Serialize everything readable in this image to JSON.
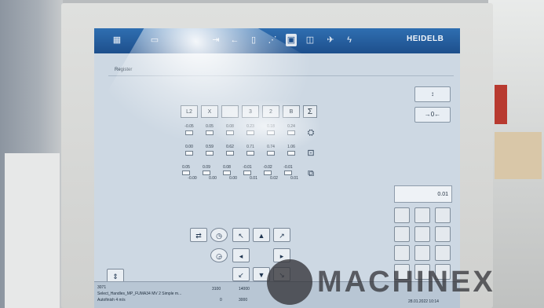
{
  "window": {
    "brand": "HEIDELB"
  },
  "toolbar": {
    "icons": [
      "grid-icon",
      "page-icon",
      "arrow-in-icon",
      "arrow-left-icon",
      "gauge-icon",
      "ink-icon",
      "lock-icon",
      "pile-icon",
      "plane-icon",
      "lightning-icon"
    ]
  },
  "tabs": [
    {
      "label": "Register"
    }
  ],
  "side": {
    "btn1": "↕",
    "btn2": "→0←"
  },
  "grid": {
    "headers": [
      "L2",
      "X",
      "",
      "3",
      "2",
      "B",
      "Σ"
    ],
    "row1": [
      "-0.05",
      "0.05",
      "0.08",
      "0.23",
      "0.18",
      "0.24"
    ],
    "row2": [
      "0.00",
      "0.59",
      "0.62",
      "0.71",
      "0.74",
      "1.06"
    ],
    "row3": [
      "0.05",
      "0.09",
      "0.08",
      "-0.01",
      "-0.02",
      "-0.01"
    ],
    "row3b": [
      "-0.00",
      "0.00",
      "0.00",
      "0.01",
      "0.02",
      "0.01"
    ]
  },
  "readout": {
    "value": "0.01"
  },
  "status": {
    "line1": "3071",
    "line2": "Select_Handles_MP_FUMA34 MV 2 Simple m...",
    "line3": "Autofinish 4 m/s",
    "v1": "3100",
    "v2": "14000",
    "v3": "0",
    "v4": "3000",
    "date": "28.01.2022 10:14"
  },
  "watermark": {
    "text": "MACHINEX"
  }
}
